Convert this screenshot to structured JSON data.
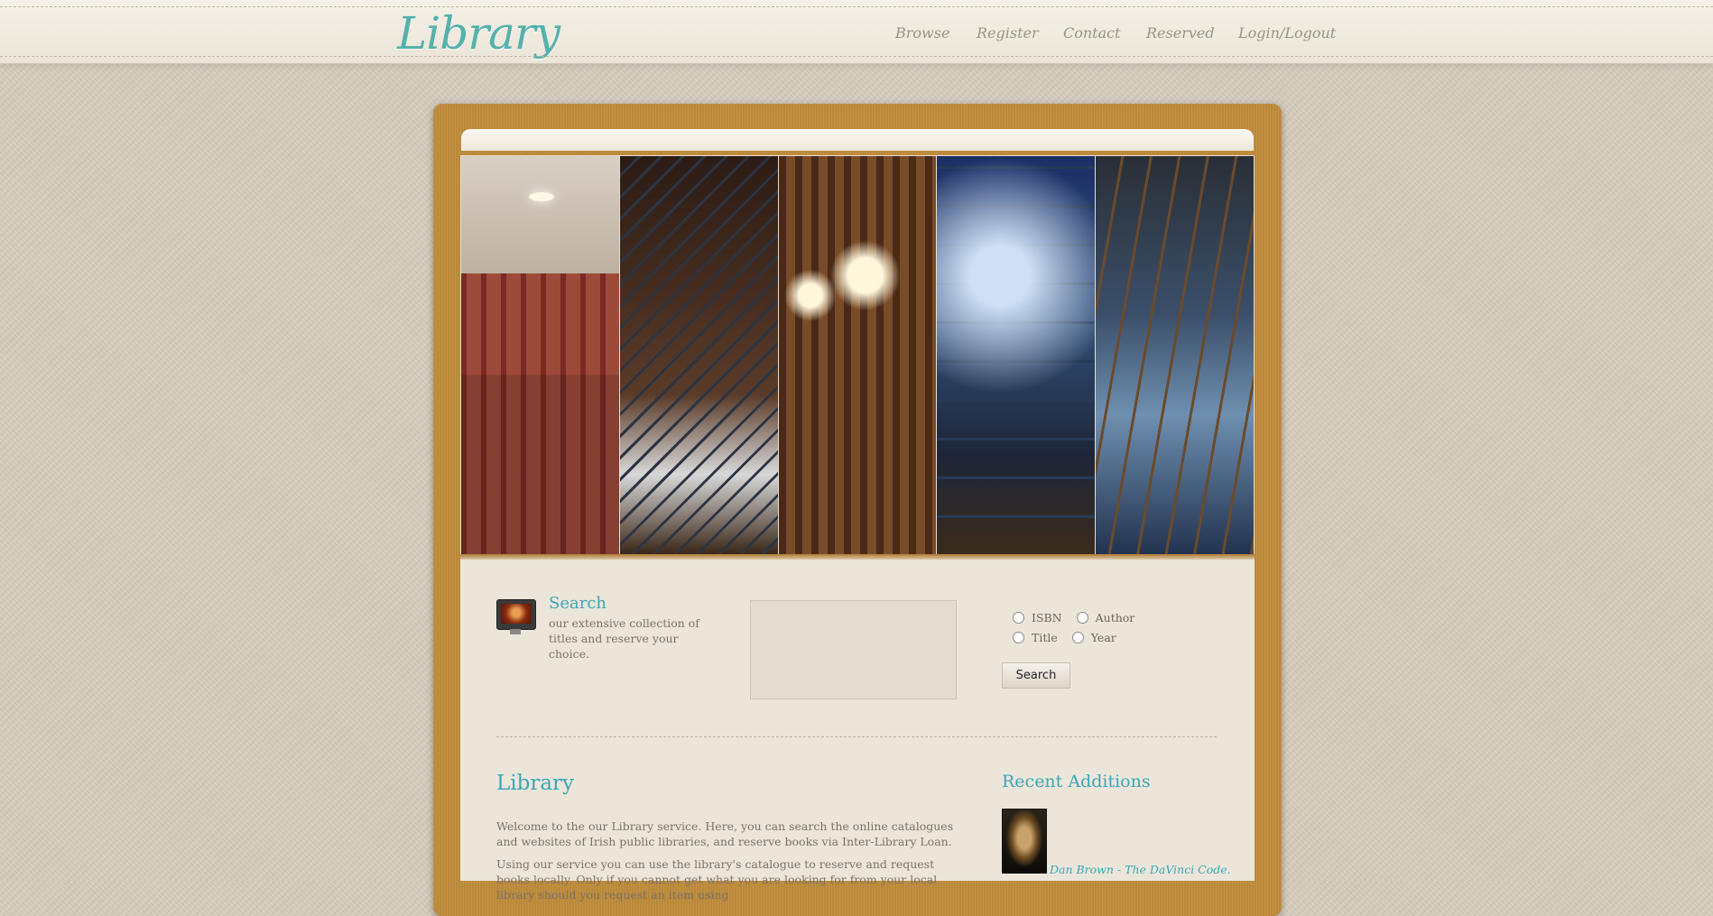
{
  "header": {
    "logo": "Library",
    "nav": [
      {
        "label": "Browse"
      },
      {
        "label": "Register"
      },
      {
        "label": "Contact"
      },
      {
        "label": "Reserved"
      },
      {
        "label": "Login/Logout"
      }
    ]
  },
  "search": {
    "title": "Search",
    "description": "our extensive collection of titles and reserve your choice.",
    "input_value": "",
    "options": [
      {
        "label": "ISBN"
      },
      {
        "label": "Author"
      },
      {
        "label": "Title"
      },
      {
        "label": "Year"
      }
    ],
    "button_label": "Search"
  },
  "main": {
    "title": "Library",
    "paragraphs": [
      "Welcome to the our Library service. Here, you can search the online catalogues and websites of Irish public libraries, and reserve books via Inter-Library Loan.",
      "Using our service you can use the library's catalogue to reserve and request books locally. Only if you cannot get what you are looking for from your local library should you request an item using"
    ]
  },
  "recent": {
    "title": "Recent Additions",
    "items": [
      {
        "label": "Dan Brown - The DaVinci Code."
      }
    ]
  },
  "colors": {
    "accent": "#3aa6b8",
    "frame": "#c18d3c",
    "logo": "#55b1ab"
  }
}
